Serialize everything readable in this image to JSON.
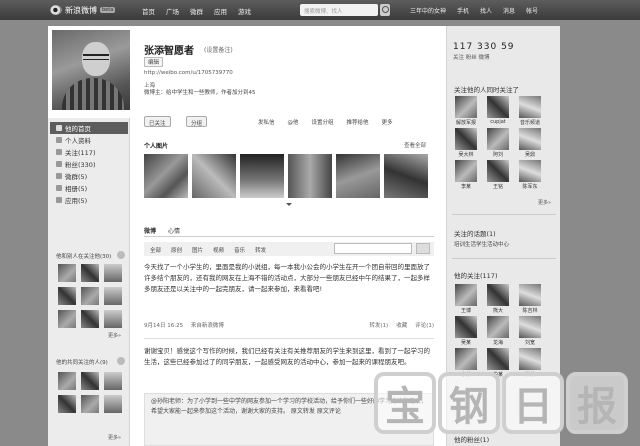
{
  "topbar": {
    "logo": "新浪微博",
    "beta": "beta",
    "nav": [
      "首页",
      "广场",
      "微群",
      "应用",
      "游戏"
    ],
    "search_placeholder": "搜索微博、找人",
    "right": [
      "三年中的女神",
      "手机",
      "找人",
      "消息",
      "帐号"
    ]
  },
  "profile": {
    "name": "张添智愿者",
    "follow_link": "(设置备注)",
    "edit_label": "编辑",
    "url": "http://weibo.com/u/1705739770",
    "location": "上海",
    "bio": "微博主：给中学生和一些教师，作者加分到45"
  },
  "stats": {
    "numbers": "117 330 59",
    "labels": "关注 粉丝 微博"
  },
  "actions": {
    "follow": "已关注",
    "group": "分组",
    "links": [
      "发私信",
      "@他",
      "设置分组",
      "推荐给他",
      "更多"
    ]
  },
  "photos": {
    "title": "个人图片",
    "more": "查看全部"
  },
  "feed": {
    "tabs": [
      "微博",
      "心情"
    ],
    "filters": [
      "全部",
      "原创",
      "图片",
      "视频",
      "音乐",
      "转发"
    ],
    "posts": [
      {
        "text": "今天找了一个小学生的，里面是我的小说组，每一本我小公会的小学生在开一个团自带回的里面放了许多结个朋友的，还有我的网友在上海不错的活动点，大部分一些朋友已经中午的结果了，一起多样多朋友还是以关注中的一起完朋友，请一起来参加，来看看吧!",
        "time": "9月14日 16:25",
        "source": "来自新浪微博",
        "actions": [
          "转发(1)",
          "收藏",
          "评论(1)"
        ]
      },
      {
        "text": "谢谢宝贝！感觉这个写作的时候，我们已经有关注有关推荐朋友的学生来到这里，看到了一起学习的生活，这些已经参加过了的同学朋友，一起感受网友的活动中心，参加一起来的课程朋友吧。"
      }
    ],
    "quote": "@孙阳老师：为了小学到一些中学的网友参加一个学习的学校活动，给予你们一些好的学习方法和建议，希望大家能一起来参加这个活动，谢谢大家的支持。 原文转发 原文评论"
  },
  "left_menu": [
    "他的首页",
    "个人资料",
    "关注(117)",
    "粉丝(330)",
    "微群(5)",
    "相册(5)",
    "应用(5)"
  ],
  "left_sections": {
    "s1_title": "他和别人在关注他(30)",
    "s2_title": "他的共同关注的人(9)",
    "more": "更多»"
  },
  "right": {
    "follow_title": "关注他的人同时关注了",
    "follow": [
      "解放军报",
      "cupjat",
      "音乐频道",
      "吴大林",
      "阿刘",
      "吴鼎",
      "李某",
      "王铭",
      "陈军东",
      "三年路",
      "马路网",
      "刘冬"
    ],
    "more": "更多»",
    "topics_title": "关注的话题(1)",
    "topic": "培训生活学生活动中心",
    "following_title": "他的关注(117)",
    "following": [
      "王博",
      "熊大",
      "陈吉林",
      "吴某",
      "龙海",
      "刘宽",
      "李某",
      "伯某",
      "洪某"
    ],
    "fans_title": "他的粉丝(1)"
  },
  "watermark": [
    "宝",
    "钢",
    "日",
    "报"
  ]
}
